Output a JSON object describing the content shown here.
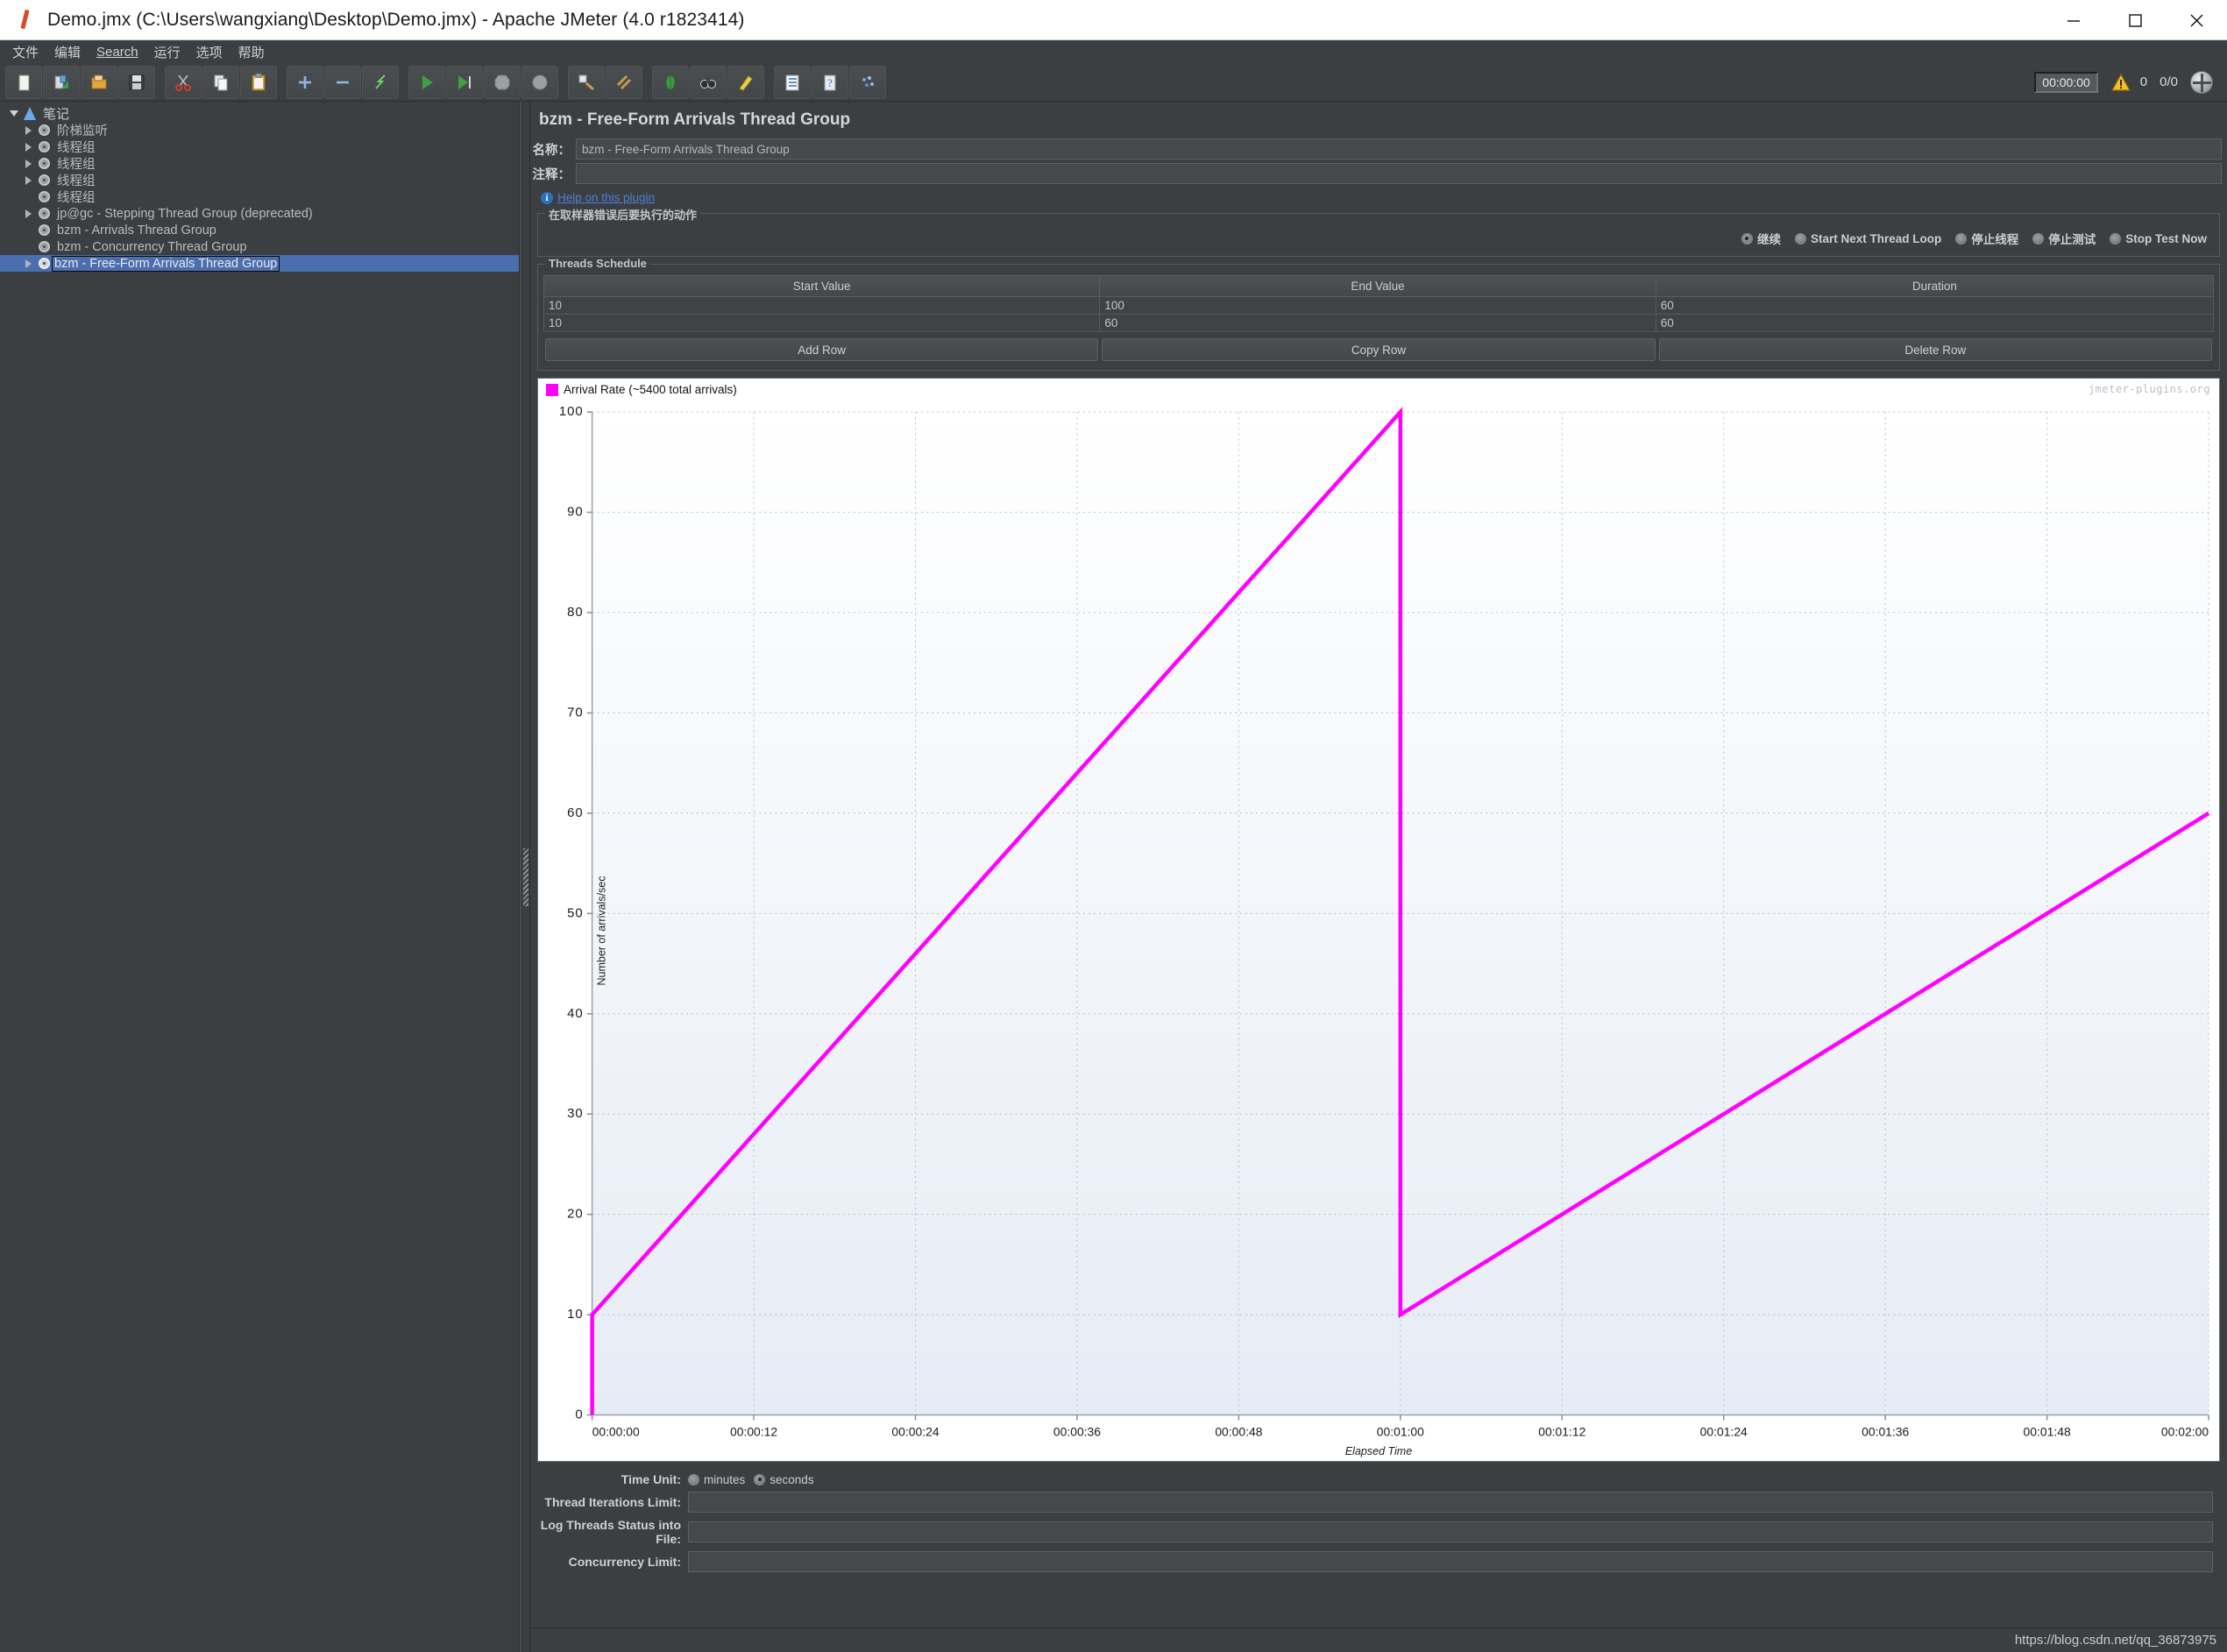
{
  "window": {
    "title": "Demo.jmx (C:\\Users\\wangxiang\\Desktop\\Demo.jmx) - Apache JMeter (4.0 r1823414)",
    "app_icon": "jmeter-feather-icon",
    "minimize": "minimize-icon",
    "maximize": "maximize-icon",
    "close": "close-icon"
  },
  "menubar": {
    "items": [
      {
        "label": "文件",
        "mnemonic": ""
      },
      {
        "label": "编辑",
        "mnemonic": ""
      },
      {
        "label": "Search",
        "mnemonic": "S"
      },
      {
        "label": "运行",
        "mnemonic": ""
      },
      {
        "label": "选项",
        "mnemonic": ""
      },
      {
        "label": "帮助",
        "mnemonic": ""
      }
    ]
  },
  "toolbar": {
    "buttons": [
      {
        "name": "new-test-plan-button",
        "icon": "page-icon"
      },
      {
        "name": "templates-button",
        "icon": "templates-icon"
      },
      {
        "name": "open-button",
        "icon": "folder-open-icon"
      },
      {
        "name": "save-button",
        "icon": "save-disk-icon"
      },
      {
        "name": "cut-button",
        "icon": "scissors-icon"
      },
      {
        "name": "copy-button",
        "icon": "copy-icon"
      },
      {
        "name": "paste-button",
        "icon": "clipboard-paste-icon"
      },
      {
        "name": "expand-all-button",
        "icon": "plus-icon"
      },
      {
        "name": "collapse-all-button",
        "icon": "minus-icon"
      },
      {
        "name": "toggle-button",
        "icon": "toggle-bolt-icon"
      },
      {
        "name": "start-button",
        "icon": "play-green-icon"
      },
      {
        "name": "start-no-pauses-button",
        "icon": "play-no-pause-icon"
      },
      {
        "name": "stop-button",
        "icon": "stop-octagon-icon"
      },
      {
        "name": "shutdown-button",
        "icon": "shutdown-circle-icon"
      },
      {
        "name": "clear-button",
        "icon": "broom-icon"
      },
      {
        "name": "clear-all-button",
        "icon": "broom-all-icon"
      },
      {
        "name": "search-button",
        "icon": "bug-green-icon"
      },
      {
        "name": "reset-search-button",
        "icon": "binoculars-icon"
      },
      {
        "name": "function-helper-button",
        "icon": "pencil-yellow-icon"
      },
      {
        "name": "log-viewer-button",
        "icon": "log-list-icon"
      },
      {
        "name": "help-button",
        "icon": "question-book-icon"
      },
      {
        "name": "undo-button",
        "icon": "scatter-icon"
      }
    ],
    "timer": "00:00:00",
    "warning_icon": "warning-triangle-icon",
    "warning_count": "0",
    "thread_count": "0/0",
    "remote_icon": "globe-icon"
  },
  "tree": {
    "items": [
      {
        "label": "笔记",
        "depth": 0,
        "twisty": "open",
        "icon": "flask-icon",
        "selected": false
      },
      {
        "label": "阶梯监听",
        "depth": 1,
        "twisty": "closed",
        "icon": "gear-icon",
        "selected": false
      },
      {
        "label": "线程组",
        "depth": 1,
        "twisty": "closed",
        "icon": "gear-icon",
        "selected": false
      },
      {
        "label": "线程组",
        "depth": 1,
        "twisty": "closed",
        "icon": "gear-icon",
        "selected": false
      },
      {
        "label": "线程组",
        "depth": 1,
        "twisty": "closed",
        "icon": "gear-icon",
        "selected": false
      },
      {
        "label": "线程组",
        "depth": 1,
        "twisty": "none",
        "icon": "gear-icon",
        "selected": false
      },
      {
        "label": "jp@gc - Stepping Thread Group (deprecated)",
        "depth": 1,
        "twisty": "closed",
        "icon": "gear-icon",
        "selected": false
      },
      {
        "label": "bzm - Arrivals Thread Group",
        "depth": 1,
        "twisty": "none",
        "icon": "gear-icon",
        "selected": false
      },
      {
        "label": "bzm - Concurrency Thread Group",
        "depth": 1,
        "twisty": "none",
        "icon": "gear-icon",
        "selected": false
      },
      {
        "label": "bzm - Free-Form Arrivals Thread Group",
        "depth": 1,
        "twisty": "closed",
        "icon": "gear-icon",
        "selected": true
      }
    ]
  },
  "panel": {
    "title": "bzm - Free-Form Arrivals Thread Group",
    "name_label": "名称：",
    "name_value": "bzm - Free-Form Arrivals Thread Group",
    "comment_label": "注释：",
    "comment_value": "",
    "help_link": "Help on this plugin",
    "help_icon": "info-icon"
  },
  "error_action": {
    "group_title": "在取样器错误后要执行的动作",
    "options": [
      {
        "label": "继续",
        "selected": true
      },
      {
        "label": "Start Next Thread Loop",
        "selected": false
      },
      {
        "label": "停止线程",
        "selected": false
      },
      {
        "label": "停止测试",
        "selected": false
      },
      {
        "label": "Stop Test Now",
        "selected": false
      }
    ]
  },
  "schedule": {
    "group_title": "Threads Schedule",
    "columns": [
      "Start Value",
      "End Value",
      "Duration"
    ],
    "rows": [
      [
        "10",
        "100",
        "60"
      ],
      [
        "10",
        "60",
        "60"
      ]
    ],
    "buttons": {
      "add": "Add Row",
      "copy": "Copy Row",
      "delete": "Delete Row"
    }
  },
  "chart_data": {
    "type": "line",
    "title": "",
    "legend": "Arrival Rate (~5400 total arrivals)",
    "legend_position": "top-left",
    "series_color": "#ff00ff",
    "watermark": "jmeter-plugins.org",
    "xlabel": "Elapsed Time",
    "ylabel": "Number of arrivals/sec",
    "xlim": [
      0,
      120
    ],
    "ylim": [
      0,
      100
    ],
    "grid": true,
    "xtick_labels": [
      "00:00:00",
      "00:00:12",
      "00:00:24",
      "00:00:36",
      "00:00:48",
      "00:01:00",
      "00:01:12",
      "00:01:24",
      "00:01:36",
      "00:01:48",
      "00:02:00"
    ],
    "xtick_values": [
      0,
      12,
      24,
      36,
      48,
      60,
      72,
      84,
      96,
      108,
      120
    ],
    "ytick_labels": [
      "0",
      "10",
      "20",
      "30",
      "40",
      "50",
      "60",
      "70",
      "80",
      "90",
      "100"
    ],
    "ytick_values": [
      0,
      10,
      20,
      30,
      40,
      50,
      60,
      70,
      80,
      90,
      100
    ],
    "series": [
      {
        "name": "Arrival Rate",
        "x": [
          0,
          0,
          60,
          60,
          120
        ],
        "y": [
          0,
          10,
          100,
          10,
          60
        ]
      }
    ]
  },
  "bottom": {
    "time_unit_label": "Time Unit:",
    "time_unit_options": [
      {
        "label": "minutes",
        "selected": false
      },
      {
        "label": "seconds",
        "selected": true
      }
    ],
    "fields": [
      {
        "label": "Thread Iterations Limit:",
        "value": ""
      },
      {
        "label": "Log Threads Status into File:",
        "value": ""
      },
      {
        "label": "Concurrency Limit:",
        "value": ""
      }
    ]
  },
  "statusbar": {
    "text": "https://blog.csdn.net/qq_36873975"
  }
}
